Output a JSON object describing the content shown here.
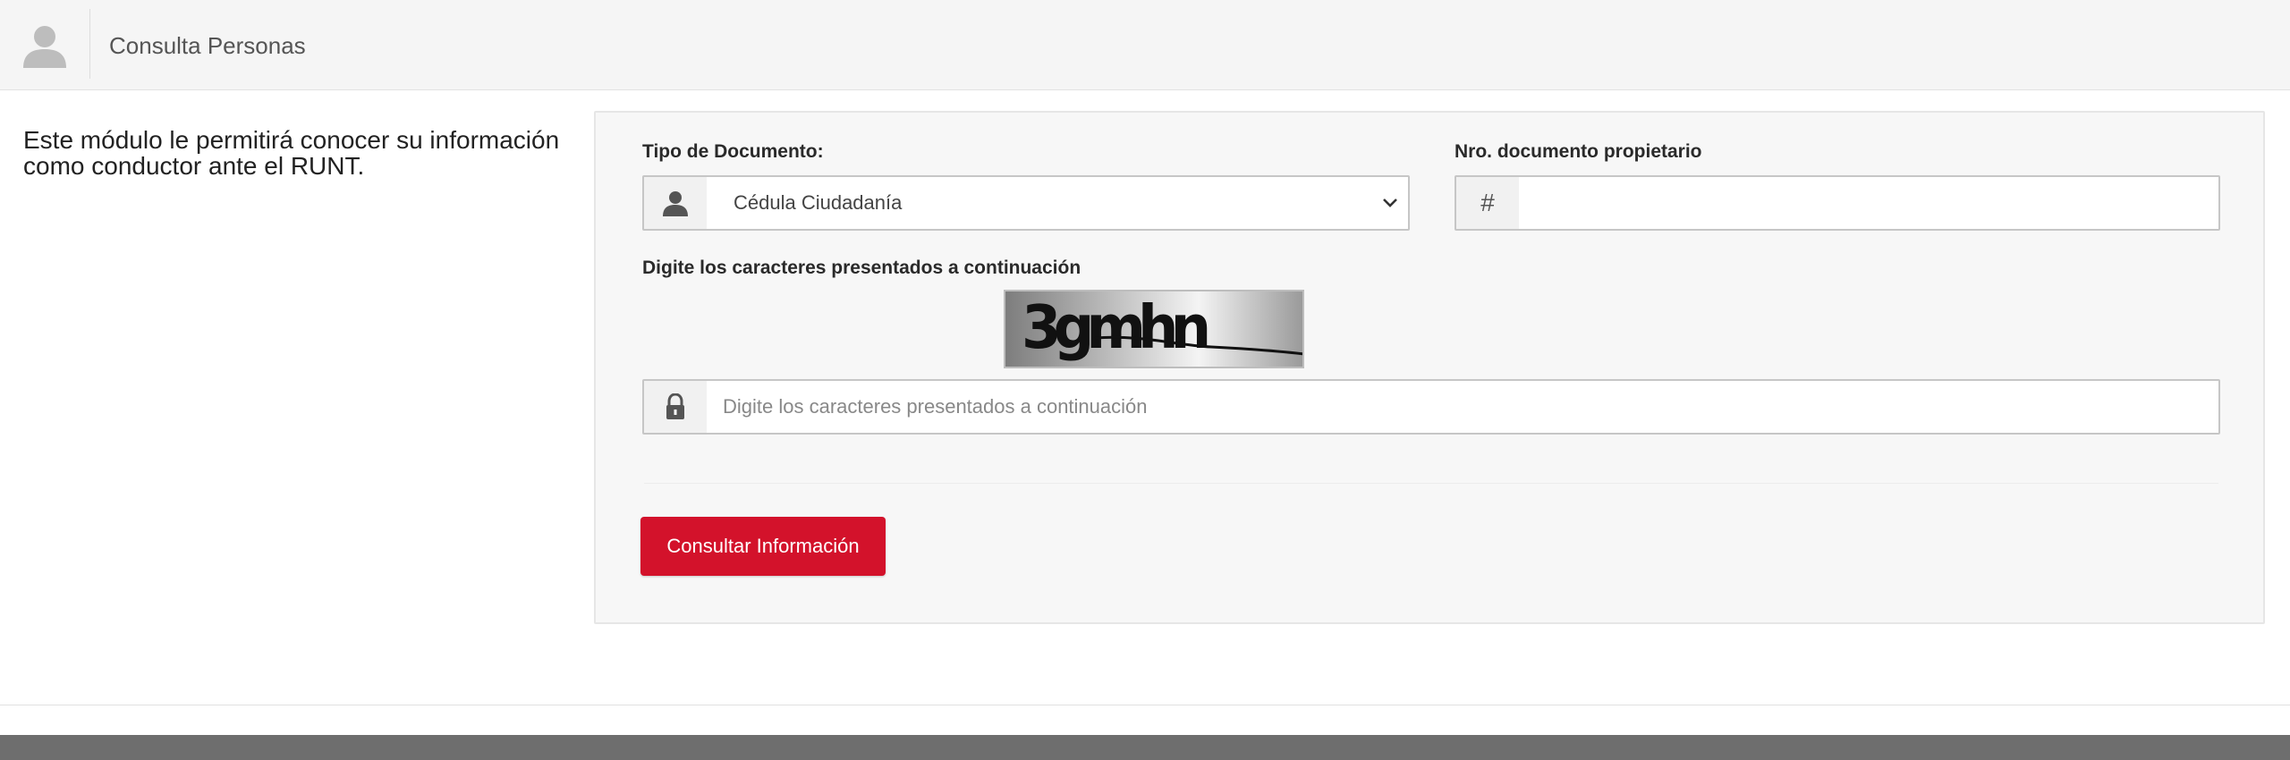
{
  "header": {
    "title": "Consulta Personas",
    "avatar_icon": "user-avatar-icon"
  },
  "intro": {
    "text": "Este módulo le permitirá conocer su información como conductor ante el RUNT."
  },
  "form": {
    "document_type": {
      "label": "Tipo de Documento:",
      "selected": "Cédula Ciudadanía",
      "icon": "user-icon"
    },
    "document_number": {
      "label": "Nro. documento propietario",
      "icon_glyph": "#",
      "value": ""
    },
    "captcha": {
      "label": "Digite los caracteres presentados a continuación",
      "image_text": "3gmhn",
      "input_placeholder": "Digite los caracteres presentados a continuación",
      "icon": "lock-icon"
    },
    "submit_label": "Consultar Información"
  },
  "colors": {
    "accent": "#d3122b",
    "header_bg": "#f5f5f5",
    "panel_bg": "#f7f7f7",
    "footer_bg": "#6e6e6e"
  }
}
